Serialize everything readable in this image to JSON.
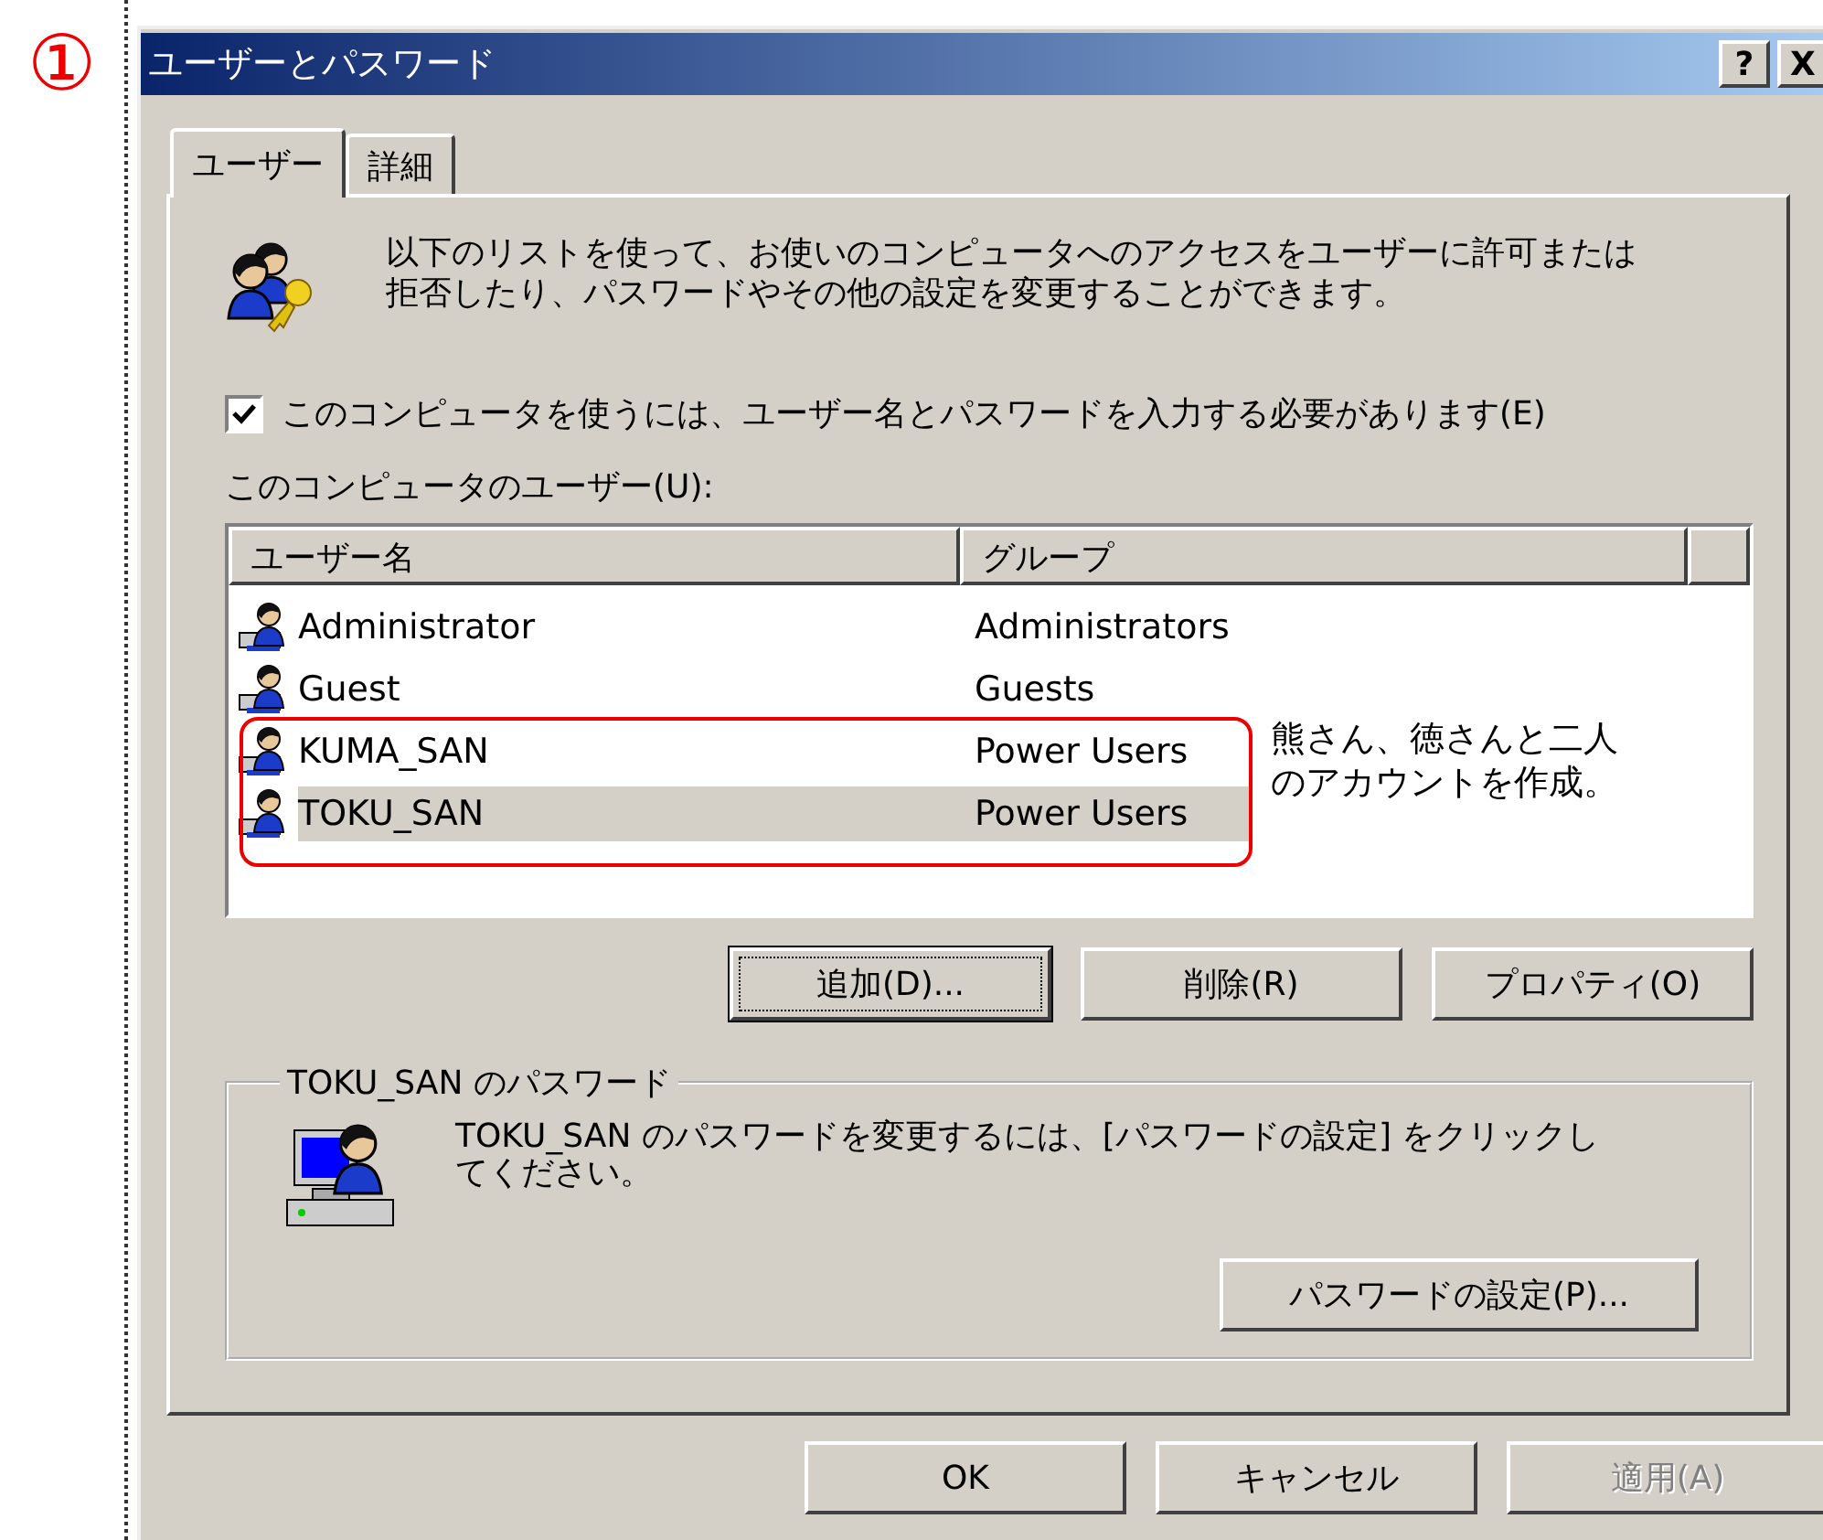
{
  "annotation_number": "①",
  "window": {
    "title": "ユーザーとパスワード",
    "help": "?",
    "close": "X"
  },
  "tabs": [
    {
      "label": "ユーザー",
      "selected": true
    },
    {
      "label": "詳細",
      "selected": false
    }
  ],
  "intro_lines": [
    "以下のリストを使って、お使いのコンピュータへのアクセスをユーザーに許可または",
    "拒否したり、パスワードやその他の設定を変更することができます。"
  ],
  "require_password": {
    "label": "このコンピュータを使うには、ユーザー名とパスワードを入力する必要があります(E)",
    "checked": true
  },
  "users_label": "このコンピュータのユーザー(U):",
  "table": {
    "columns": [
      "ユーザー名",
      "グループ"
    ],
    "rows": [
      {
        "name": "Administrator",
        "group": "Administrators",
        "selected": false
      },
      {
        "name": "Guest",
        "group": "Guests",
        "selected": false
      },
      {
        "name": "KUMA_SAN",
        "group": "Power Users",
        "selected": false
      },
      {
        "name": "TOKU_SAN",
        "group": "Power Users",
        "selected": true
      }
    ]
  },
  "note_lines": [
    "熊さん、徳さんと二人",
    "のアカウントを作成。"
  ],
  "list_buttons": [
    {
      "label": "追加(D)...",
      "focused": true
    },
    {
      "label": "削除(R)",
      "focused": false
    },
    {
      "label": "プロパティ(O)",
      "focused": false
    }
  ],
  "password_group": {
    "title": "TOKU_SAN のパスワード",
    "text_lines": [
      "TOKU_SAN のパスワードを変更するには、[パスワードの設定] をクリックし",
      "てください。"
    ],
    "button": "パスワードの設定(P)..."
  },
  "footer_buttons": [
    {
      "label": "OK",
      "disabled": false
    },
    {
      "label": "キャンセル",
      "disabled": false
    },
    {
      "label": "適用(A)",
      "disabled": true
    }
  ]
}
